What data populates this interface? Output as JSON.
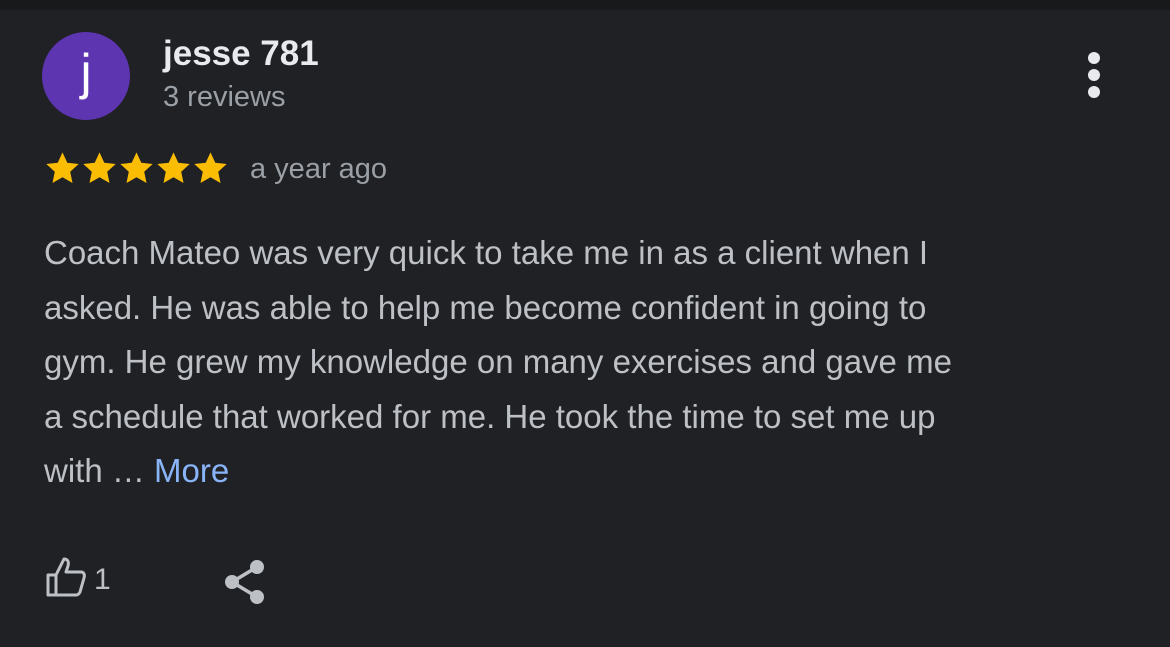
{
  "review": {
    "avatar_letter": "j",
    "avatar_color": "#5e35b1",
    "author_name": "jesse 781",
    "author_reviews": "3 reviews",
    "rating": 5,
    "rating_max": 5,
    "star_color": "#fbbc04",
    "time_ago": "a year ago",
    "text_lines": [
      "Coach Mateo was very quick to take me in as a client when I",
      "asked. He was able to help me become confident in going to",
      "gym. He grew my knowledge on many exercises and gave me",
      "a schedule that worked for me. He took the time to set me up",
      "with … "
    ],
    "more_label": "More",
    "like_count": "1",
    "menu_icon": "more-vert-icon",
    "like_icon": "thumb-up-icon",
    "share_icon": "share-icon"
  }
}
